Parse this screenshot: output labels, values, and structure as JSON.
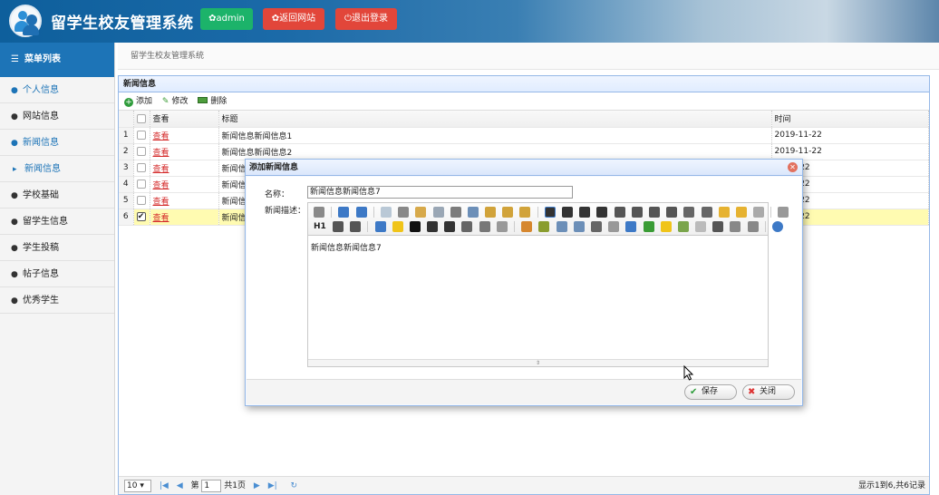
{
  "header": {
    "title": "留学生校友管理系统",
    "admin_label": "✿admin",
    "back_label": "✿返回网站",
    "logout_label": "⏻退出登录"
  },
  "sidebar": {
    "title": "菜单列表",
    "items": [
      {
        "label": "个人信息"
      },
      {
        "label": "网站信息"
      },
      {
        "label": "新闻信息"
      },
      {
        "label": "新闻信息"
      },
      {
        "label": "学校基础"
      },
      {
        "label": "留学生信息"
      },
      {
        "label": "学生投稿"
      },
      {
        "label": "帖子信息"
      },
      {
        "label": "优秀学生"
      }
    ]
  },
  "breadcrumb": "留学生校友管理系统",
  "panel": {
    "title": "新闻信息",
    "toolbar": {
      "add": "添加",
      "edit": "修改",
      "delete": "删除"
    },
    "columns": {
      "view": "查看",
      "title": "标题",
      "time": "时间"
    },
    "rows": [
      {
        "n": "1",
        "view": "查看",
        "title": "新闻信息新闻信息1",
        "time": "2019-11-22"
      },
      {
        "n": "2",
        "view": "查看",
        "title": "新闻信息新闻信息2",
        "time": "2019-11-22"
      },
      {
        "n": "3",
        "view": "查看",
        "title": "新闻信",
        "time": "11-22"
      },
      {
        "n": "4",
        "view": "查看",
        "title": "新闻信",
        "time": "11-22"
      },
      {
        "n": "5",
        "view": "查看",
        "title": "新闻信",
        "time": "11-22"
      },
      {
        "n": "6",
        "view": "查看",
        "title": "新闻信",
        "time": "11-22"
      }
    ]
  },
  "pager": {
    "page_size": "10 ▾",
    "page_prefix": "第",
    "page_value": "1",
    "page_suffix": "共1页",
    "info": "显示1到6,共6记录"
  },
  "dialog": {
    "title": "添加新闻信息",
    "name_label": "名称：",
    "name_value": "新闻信息新闻信息7",
    "desc_label": "新闻描述：",
    "editor_content": "新闻信息新闻信息7",
    "editor_heading": "H1",
    "save_label": "保存",
    "close_label": "关闭"
  }
}
